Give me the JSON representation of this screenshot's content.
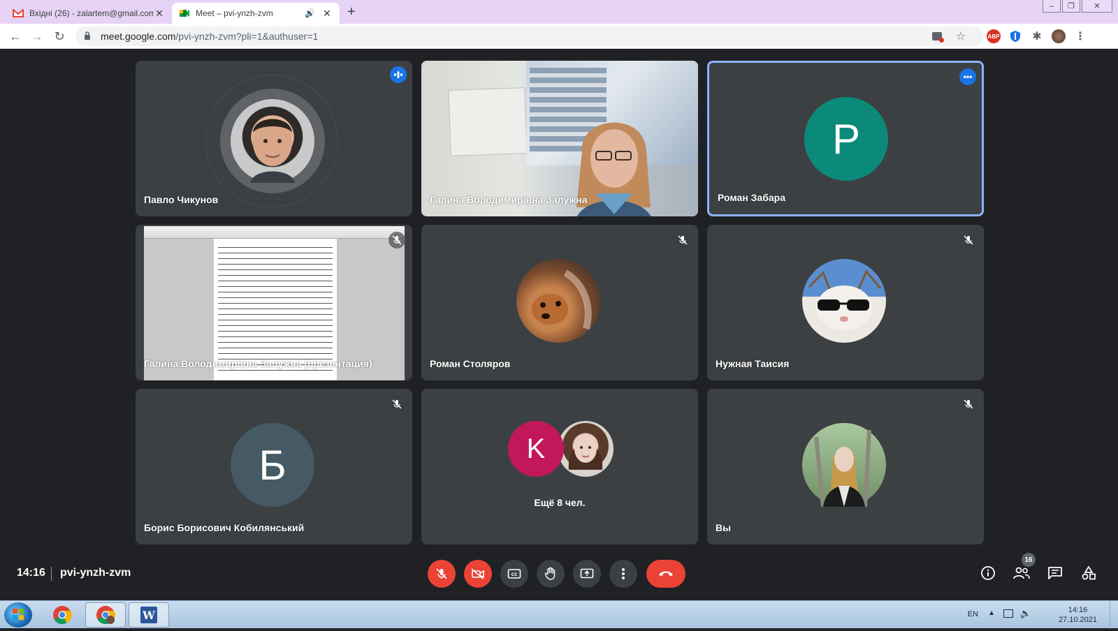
{
  "browser": {
    "tabs": [
      {
        "title": "Вхідні (26) - zalartem@gmail.com",
        "icon": "gmail-icon",
        "active": false
      },
      {
        "title": "Meet – pvi-ynzh-zvm",
        "icon": "meet-icon",
        "active": true
      }
    ],
    "url_host": "meet.google.com",
    "url_path": "/pvi-ynzh-zvm?pli=1&authuser=1"
  },
  "tiles": [
    {
      "name": "Павло Чикунов",
      "kind": "photo",
      "speaking": true
    },
    {
      "name": "Галина Володимирівна Залужна",
      "kind": "video"
    },
    {
      "name": "Роман Забара",
      "kind": "letter",
      "letter": "P",
      "color": "#0b8a79",
      "pinned": true
    },
    {
      "name": "Галина Володимирівна Залужна (презентация)",
      "kind": "presentation"
    },
    {
      "name": "Роман Столяров",
      "kind": "photo",
      "muted": true
    },
    {
      "name": "Нужная Таисия",
      "kind": "photo",
      "muted": true
    },
    {
      "name": "Борис Борисович Кобилянський",
      "kind": "letter",
      "letter": "Б",
      "color": "#455a64",
      "muted": true
    },
    {
      "name": "Ещё 8 чел.",
      "kind": "group",
      "letter": "K",
      "color": "#c2185b"
    },
    {
      "name": "Вы",
      "kind": "photo",
      "muted": true
    }
  ],
  "meeting": {
    "time": "14:16",
    "code": "pvi-ynzh-zvm",
    "participants_count": "16"
  },
  "taskbar": {
    "lang": "EN",
    "clock_time": "14:16",
    "clock_date": "27.10.2021"
  },
  "colors": {
    "stage_bg": "#202124",
    "tile_bg": "#3c4043",
    "danger": "#ea4335",
    "accent": "#1a73e8"
  }
}
